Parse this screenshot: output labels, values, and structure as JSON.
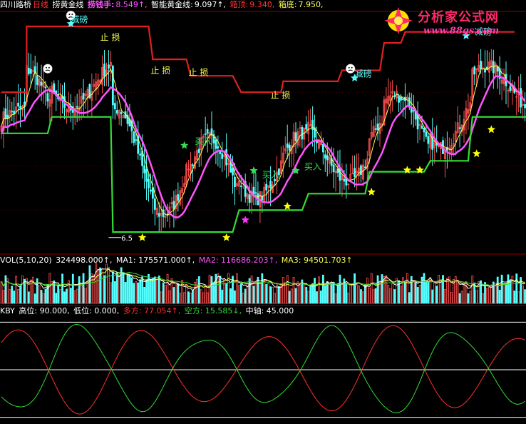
{
  "header_main": {
    "stock": "四川路桥",
    "period": "日线",
    "indicator": "捞黄金线",
    "l1_label": "捞钱手:",
    "l1_value": "8.549↑,",
    "l2_label": "智能黄金线:",
    "l2_value": "9.097↑,",
    "l3_label": "箱顶:",
    "l3_value": "9.340,",
    "l4_label": "箱底:",
    "l4_value": "7.950,"
  },
  "header_vol": {
    "name": "VOL(5,10,20)",
    "v1": "324498.000↑,",
    "ma1": "MA1: 175571.000↑,",
    "ma2": "MA2: 116686.203↑,",
    "ma3": "MA3: 94501.703↑"
  },
  "header_kby": {
    "name": "KBY",
    "gao": "高位: 90.000,",
    "di": "低位: 0.000,",
    "duo": "多方: 77.054↑,",
    "kong": "空方: 15.585↓,",
    "zhong": "中轴: 45.000"
  },
  "logo": {
    "title": "分析家公式网",
    "url": "www.88gs.com"
  },
  "colors": {
    "up": "#ff5050",
    "down": "#54ffff",
    "ma_yellow": "#ffff54",
    "ma_magenta": "#ff54ff",
    "box_top": "#e02020",
    "box_bottom": "#33dd33",
    "star_yellow": "#ffff00",
    "star_green": "#33dd55",
    "star_cyan": "#54ffff",
    "star_magenta": "#ff33ff"
  },
  "chart_data": [
    {
      "type": "candlestick",
      "panel": "main",
      "ylim": [
        6.4,
        10.8
      ],
      "low_label": "6.5",
      "box_top": [
        {
          "x": 0,
          "y": 9.3
        },
        {
          "x": 12,
          "y": 9.3
        },
        {
          "x": 12,
          "y": 10.5
        },
        {
          "x": 70,
          "y": 10.5
        },
        {
          "x": 72,
          "y": 9.9
        },
        {
          "x": 88,
          "y": 9.9
        },
        {
          "x": 90,
          "y": 9.6
        },
        {
          "x": 110,
          "y": 9.6
        },
        {
          "x": 114,
          "y": 9.3
        },
        {
          "x": 133,
          "y": 9.3
        },
        {
          "x": 134,
          "y": 9.5
        },
        {
          "x": 160,
          "y": 9.5
        },
        {
          "x": 162,
          "y": 9.7
        },
        {
          "x": 180,
          "y": 9.7
        },
        {
          "x": 182,
          "y": 10.2
        },
        {
          "x": 190,
          "y": 10.2
        },
        {
          "x": 192,
          "y": 10.4
        },
        {
          "x": 244,
          "y": 10.4
        }
      ],
      "box_bottom": [
        {
          "x": 0,
          "y": 8.55
        },
        {
          "x": 22,
          "y": 8.55
        },
        {
          "x": 24,
          "y": 8.85
        },
        {
          "x": 52,
          "y": 8.85
        },
        {
          "x": 53,
          "y": 6.75
        },
        {
          "x": 110,
          "y": 6.75
        },
        {
          "x": 113,
          "y": 7.15
        },
        {
          "x": 143,
          "y": 7.15
        },
        {
          "x": 146,
          "y": 7.45
        },
        {
          "x": 173,
          "y": 7.45
        },
        {
          "x": 175,
          "y": 7.85
        },
        {
          "x": 201,
          "y": 7.85
        },
        {
          "x": 204,
          "y": 8.05
        },
        {
          "x": 222,
          "y": 8.05
        },
        {
          "x": 224,
          "y": 8.85
        },
        {
          "x": 250,
          "y": 8.85
        }
      ],
      "labels": [
        {
          "text": "止 损",
          "x": 47,
          "y": 10.25,
          "color": "#ffff54"
        },
        {
          "text": "止 损",
          "x": 71,
          "y": 9.64,
          "color": "#ffff54"
        },
        {
          "text": "止 损",
          "x": 89,
          "y": 9.61,
          "color": "#ffff54"
        },
        {
          "text": "止 损",
          "x": 128,
          "y": 9.19,
          "color": "#ffff54"
        },
        {
          "text": "减磅",
          "x": 33,
          "y": 10.57,
          "color": "#54ffff"
        },
        {
          "text": "减磅",
          "x": 168,
          "y": 9.58,
          "color": "#54ffff"
        },
        {
          "text": "减磅",
          "x": 225,
          "y": 10.35,
          "color": "#54ffff"
        },
        {
          "text": "买入",
          "x": 92,
          "y": 8.35,
          "color": "#33dd55"
        },
        {
          "text": "买入",
          "x": 124,
          "y": 7.74,
          "color": "#33dd55"
        },
        {
          "text": "买入",
          "x": 144,
          "y": 7.89,
          "color": "#33dd55"
        }
      ],
      "stars": [
        {
          "x": 33,
          "y": 10.55,
          "color": "star_cyan"
        },
        {
          "x": 168,
          "y": 9.56,
          "color": "star_cyan"
        },
        {
          "x": 221,
          "y": 10.33,
          "color": "star_cyan"
        },
        {
          "x": 87,
          "y": 8.33,
          "color": "star_green"
        },
        {
          "x": 120,
          "y": 7.87,
          "color": "star_green"
        },
        {
          "x": 140,
          "y": 7.87,
          "color": "star_green"
        },
        {
          "x": 267,
          "y": 9.06,
          "color": "star_green"
        },
        {
          "x": 67,
          "y": 6.65,
          "color": "star_yellow"
        },
        {
          "x": 107,
          "y": 6.65,
          "color": "star_yellow"
        },
        {
          "x": 136,
          "y": 7.22,
          "color": "star_yellow"
        },
        {
          "x": 176,
          "y": 7.48,
          "color": "star_yellow"
        },
        {
          "x": 193,
          "y": 7.88,
          "color": "star_yellow"
        },
        {
          "x": 199,
          "y": 7.88,
          "color": "star_yellow"
        },
        {
          "x": 226,
          "y": 8.18,
          "color": "star_yellow"
        },
        {
          "x": 233,
          "y": 8.62,
          "color": "star_yellow"
        },
        {
          "x": 260,
          "y": 8.45,
          "color": "star_yellow"
        },
        {
          "x": 116,
          "y": 6.97,
          "color": "star_magenta"
        }
      ],
      "smileys": [
        {
          "x": 33,
          "y": 10.7
        },
        {
          "x": 22,
          "y": 9.73
        },
        {
          "x": 166,
          "y": 9.73
        }
      ]
    },
    {
      "type": "bar",
      "panel": "volume",
      "series": [
        {
          "name": "MA1"
        },
        {
          "name": "MA2"
        },
        {
          "name": "MA3"
        }
      ]
    },
    {
      "type": "line",
      "panel": "kby",
      "ylim": [
        -5,
        95
      ],
      "levels": {
        "high": 90,
        "low": 0,
        "mid": 45
      },
      "series": [
        {
          "name": "多方",
          "color": "#ff3030"
        },
        {
          "name": "空方",
          "color": "#33dd33"
        }
      ]
    }
  ]
}
